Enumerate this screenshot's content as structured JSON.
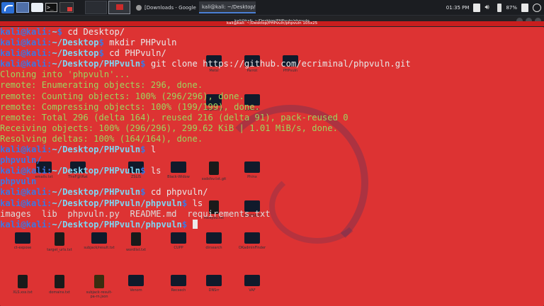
{
  "panel": {
    "task1": "[Downloads - Google Ch...",
    "task2": "kali@kali: ~/Desktop/PH...",
    "clock": "01:35 PM",
    "battery": "87%"
  },
  "window": {
    "title": "kali@kali: ~/Desktop/PHPvuln/phpvuln",
    "subtitle": "kali@kali: ~/Desktop/PHPvuln/phpvuln 105x25"
  },
  "desktop_icons": [
    "Metsl",
    "Parrot",
    "PHPvuln",
    "targets.txt",
    "DIRecon",
    "emails.txt",
    "TheF@tRat",
    "ZSLIS",
    "Black-Widow",
    "ssdsfsv.txt.git",
    "Phinx",
    "rockyou.txt",
    "AntOSINT",
    "ct-expose",
    "target_urls.txt",
    "subjack/result.txt",
    "wordlist.txt",
    "CUPP",
    "dirsearch",
    "OKadminFinder",
    "XLS.xss.txt",
    "domains.txt",
    "subjack-result-pa-rn.json",
    "Venom",
    "Recsech",
    "DNSrr",
    "VAF"
  ],
  "terminal": {
    "prompt_user": "kali@kali",
    "lines": [
      {
        "path": "~",
        "cmd": "cd Desktop/"
      },
      {
        "path": "~/Desktop",
        "cmd": "mkdir PHPvuln"
      },
      {
        "path": "~/Desktop",
        "cmd": "cd PHPvuln/"
      },
      {
        "path": "~/Desktop/PHPvuln",
        "cmd": "git clone https://github.com/ecriminal/phpvuln.git"
      },
      {
        "out": "Cloning into 'phpvuln'..."
      },
      {
        "out": "remote: Enumerating objects: 296, done."
      },
      {
        "out": "remote: Counting objects: 100% (296/296), done."
      },
      {
        "out": "remote: Compressing objects: 100% (199/199), done."
      },
      {
        "out": "remote: Total 296 (delta 164), reused 216 (delta 91), pack-reused 0"
      },
      {
        "out": "Receiving objects: 100% (296/296), 299.62 KiB | 1.01 MiB/s, done."
      },
      {
        "out": "Resolving deltas: 100% (164/164), done."
      },
      {
        "path": "~/Desktop/PHPvuln",
        "cmd": "l"
      },
      {
        "dir": "phpvuln/"
      },
      {
        "path": "~/Desktop/PHPvuln",
        "cmd": "ls"
      },
      {
        "dir": "phpvuln"
      },
      {
        "path": "~/Desktop/PHPvuln",
        "cmd": "cd phpvuln/"
      },
      {
        "path": "~/Desktop/PHPvuln/phpvuln",
        "cmd": "ls"
      },
      {
        "listing": [
          "images",
          "lib",
          "phpvuln.py",
          "README.md",
          "requirements.txt"
        ]
      },
      {
        "path": "~/Desktop/PHPvuln/phpvuln",
        "cmd": "",
        "cursor": true
      }
    ]
  }
}
